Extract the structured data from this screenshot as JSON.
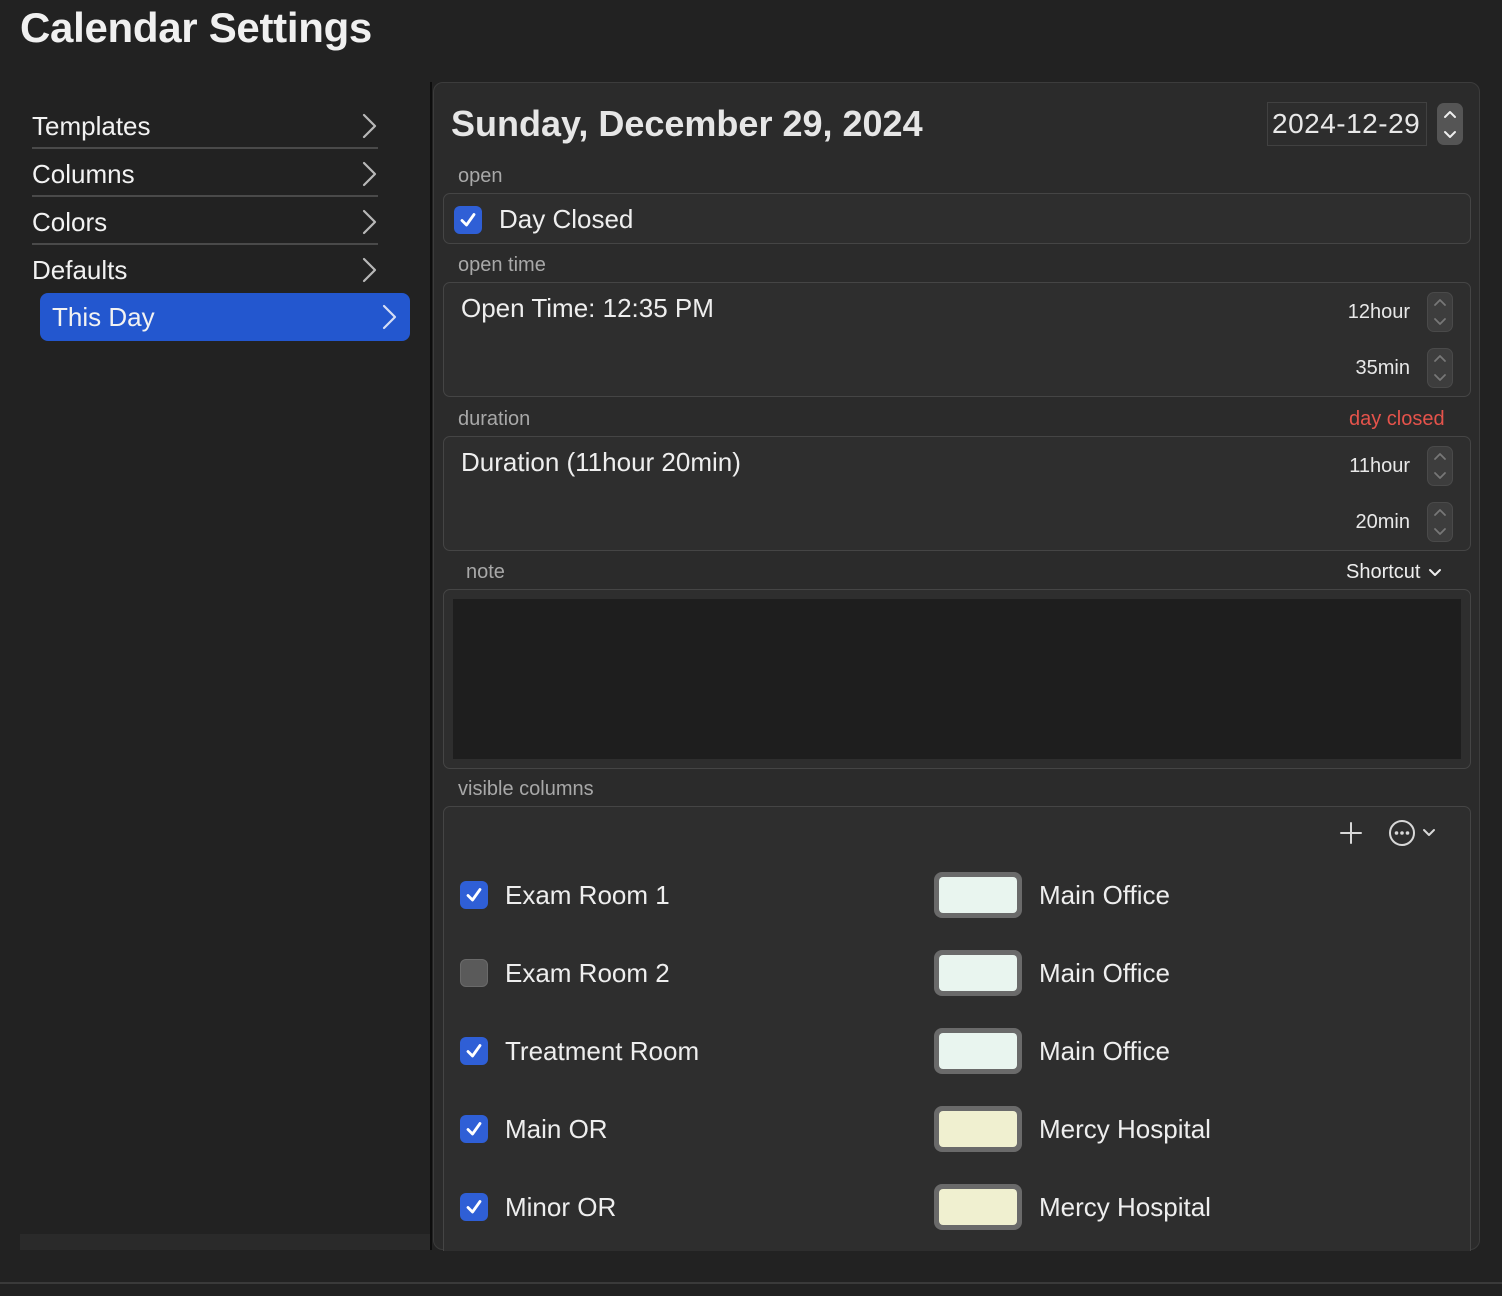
{
  "window": {
    "title": "Calendar Settings"
  },
  "sidebar": {
    "items": [
      {
        "label": "Templates",
        "selected": false
      },
      {
        "label": "Columns",
        "selected": false
      },
      {
        "label": "Colors",
        "selected": false
      },
      {
        "label": "Defaults",
        "selected": false
      },
      {
        "label": "This Day",
        "selected": true
      }
    ],
    "accent": "#2357cf"
  },
  "day": {
    "title": "Sunday, December 29, 2024",
    "date_value": "2024-12-29"
  },
  "open": {
    "section_label": "open",
    "day_closed_label": "Day Closed",
    "day_closed_checked": true
  },
  "open_time": {
    "section_label": "open time",
    "text": "Open Time: 12:35 PM",
    "hour_label": "12hour",
    "min_label": "35min"
  },
  "duration": {
    "section_label": "duration",
    "warning": "day closed",
    "text": "Duration (11hour 20min)",
    "hour_label": "11hour",
    "min_label": "20min"
  },
  "note": {
    "section_label": "note",
    "shortcut_label": "Shortcut",
    "value": ""
  },
  "visible_columns": {
    "section_label": "visible columns",
    "rows": [
      {
        "name": "Exam Room 1",
        "checked": true,
        "color": "#e9f5ef",
        "location": "Main Office"
      },
      {
        "name": "Exam Room 2",
        "checked": false,
        "color": "#e9f5ef",
        "location": "Main Office"
      },
      {
        "name": "Treatment Room",
        "checked": true,
        "color": "#e9f5ef",
        "location": "Main Office"
      },
      {
        "name": "Main OR",
        "checked": true,
        "color": "#f0f0d0",
        "location": "Mercy Hospital"
      },
      {
        "name": "Minor OR",
        "checked": true,
        "color": "#f0f0d0",
        "location": "Mercy Hospital"
      }
    ]
  },
  "icons": {
    "chevron": "chevron-right-icon",
    "add": "plus-icon",
    "more": "ellipsis-circle-icon"
  }
}
